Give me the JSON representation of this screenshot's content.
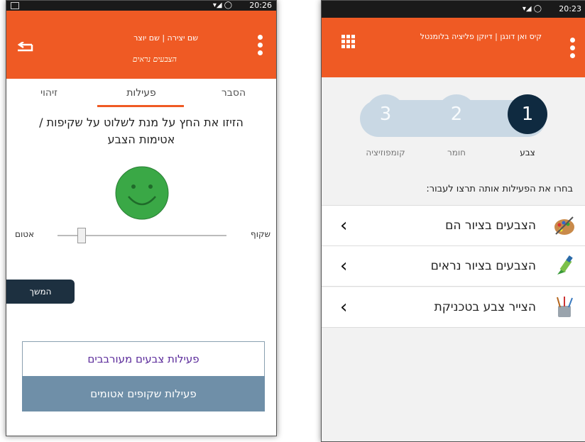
{
  "left_phone": {
    "status": {
      "time": "20:26"
    },
    "header": {
      "title": "שם יצירה | שם יוצר",
      "subtitle": "הצבעים נראים"
    },
    "tabs": [
      {
        "label": "הסבר",
        "active": false
      },
      {
        "label": "פעילות",
        "active": true
      },
      {
        "label": "זיהוי",
        "active": false
      }
    ],
    "instruction": "הזיזו את החץ על מנת לשלוט על שקיפות / אטימות הצבע",
    "slider": {
      "left_label": "אטום",
      "right_label": "שקוף",
      "level_percent": 15
    },
    "continue_button": "המשך",
    "activities": [
      {
        "label": "פעילות צבעים מעורבבים"
      },
      {
        "label": "פעילות שקופים אטומים"
      }
    ],
    "colors": {
      "accent": "#ef5a24",
      "smiley": "#3aa846",
      "dark_button": "#1d3040",
      "selected_activity": "#6f8fa8"
    }
  },
  "right_phone": {
    "status": {
      "time": "20:23"
    },
    "header": {
      "title": "קיס ואן דונגן | דיוקן פליציה בלומנטל"
    },
    "steps": [
      {
        "number": "1",
        "label": "צבע",
        "active": true
      },
      {
        "number": "2",
        "label": "חומר",
        "active": false
      },
      {
        "number": "3",
        "label": "קומפוזיציה",
        "active": false
      }
    ],
    "choose_text": "בחרו את הפעילות אותה תרצו לעבור:",
    "list": [
      {
        "label": "הצבעים בציור הם",
        "icon": "palette-icon"
      },
      {
        "label": "הצבעים בציור נראים",
        "icon": "brush-icon"
      },
      {
        "label": "הצייר צבע בטכניקת",
        "icon": "paint-jar-icon"
      }
    ],
    "colors": {
      "accent": "#ef5a24",
      "step_active": "#0f2a40",
      "step_inactive": "#c9d8e4"
    }
  }
}
